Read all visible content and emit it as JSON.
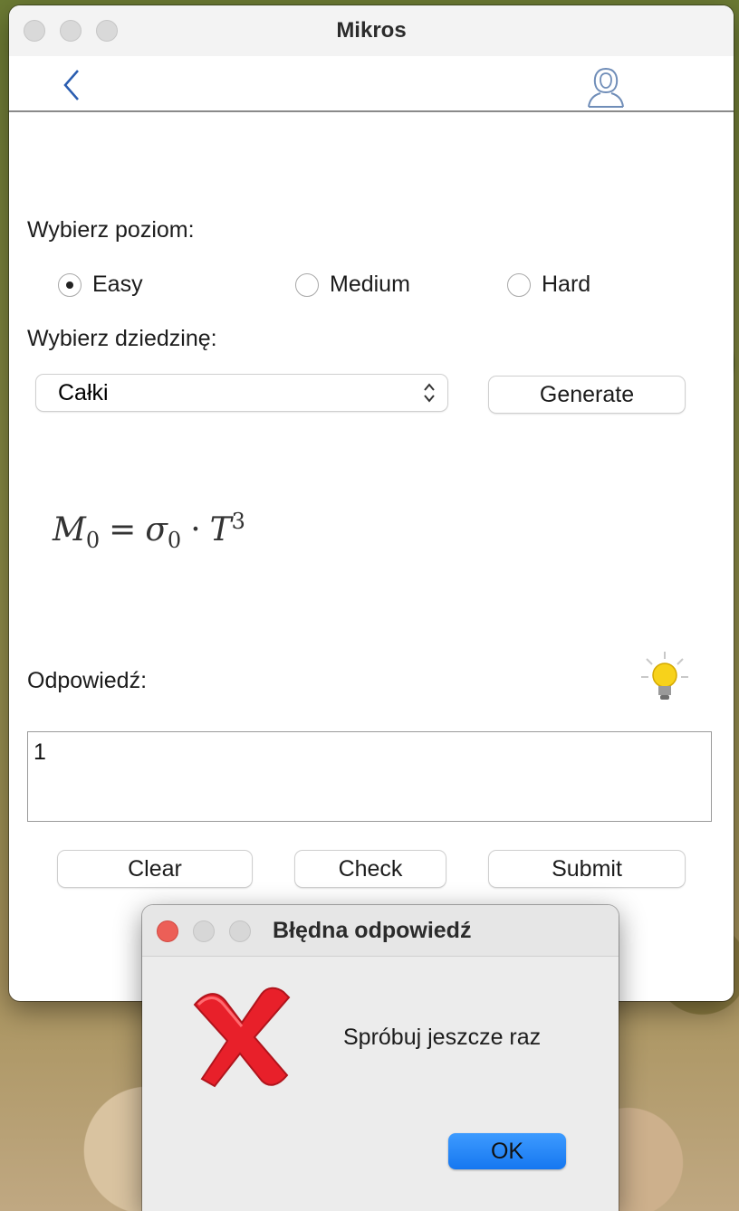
{
  "window": {
    "title": "Mikros"
  },
  "form": {
    "level_label": "Wybierz poziom:",
    "levels": [
      {
        "label": "Easy",
        "selected": true
      },
      {
        "label": "Medium",
        "selected": false
      },
      {
        "label": "Hard",
        "selected": false
      }
    ],
    "domain_label": "Wybierz dziedzinę:",
    "domain_value": "Całki",
    "generate_label": "Generate",
    "formula": {
      "lhs": "M",
      "lhs_sub": "0",
      "op": "=",
      "rhs": "σ",
      "rhs_sub": "0",
      "dot": "·",
      "rhs2": "T",
      "rhs2_sup": "3"
    },
    "answer_label": "Odpowiedź:",
    "answer_value": "1",
    "clear_label": "Clear",
    "check_label": "Check",
    "submit_label": "Submit"
  },
  "dialog": {
    "title": "Błędna odpowiedź",
    "message": "Spróbuj jeszcze raz",
    "ok_label": "OK",
    "close_color": "#ec5f57"
  },
  "icons": {
    "back": "chevron-left-icon",
    "user": "user-profile-icon",
    "hint": "lightbulb-icon",
    "error": "red-x-icon"
  }
}
